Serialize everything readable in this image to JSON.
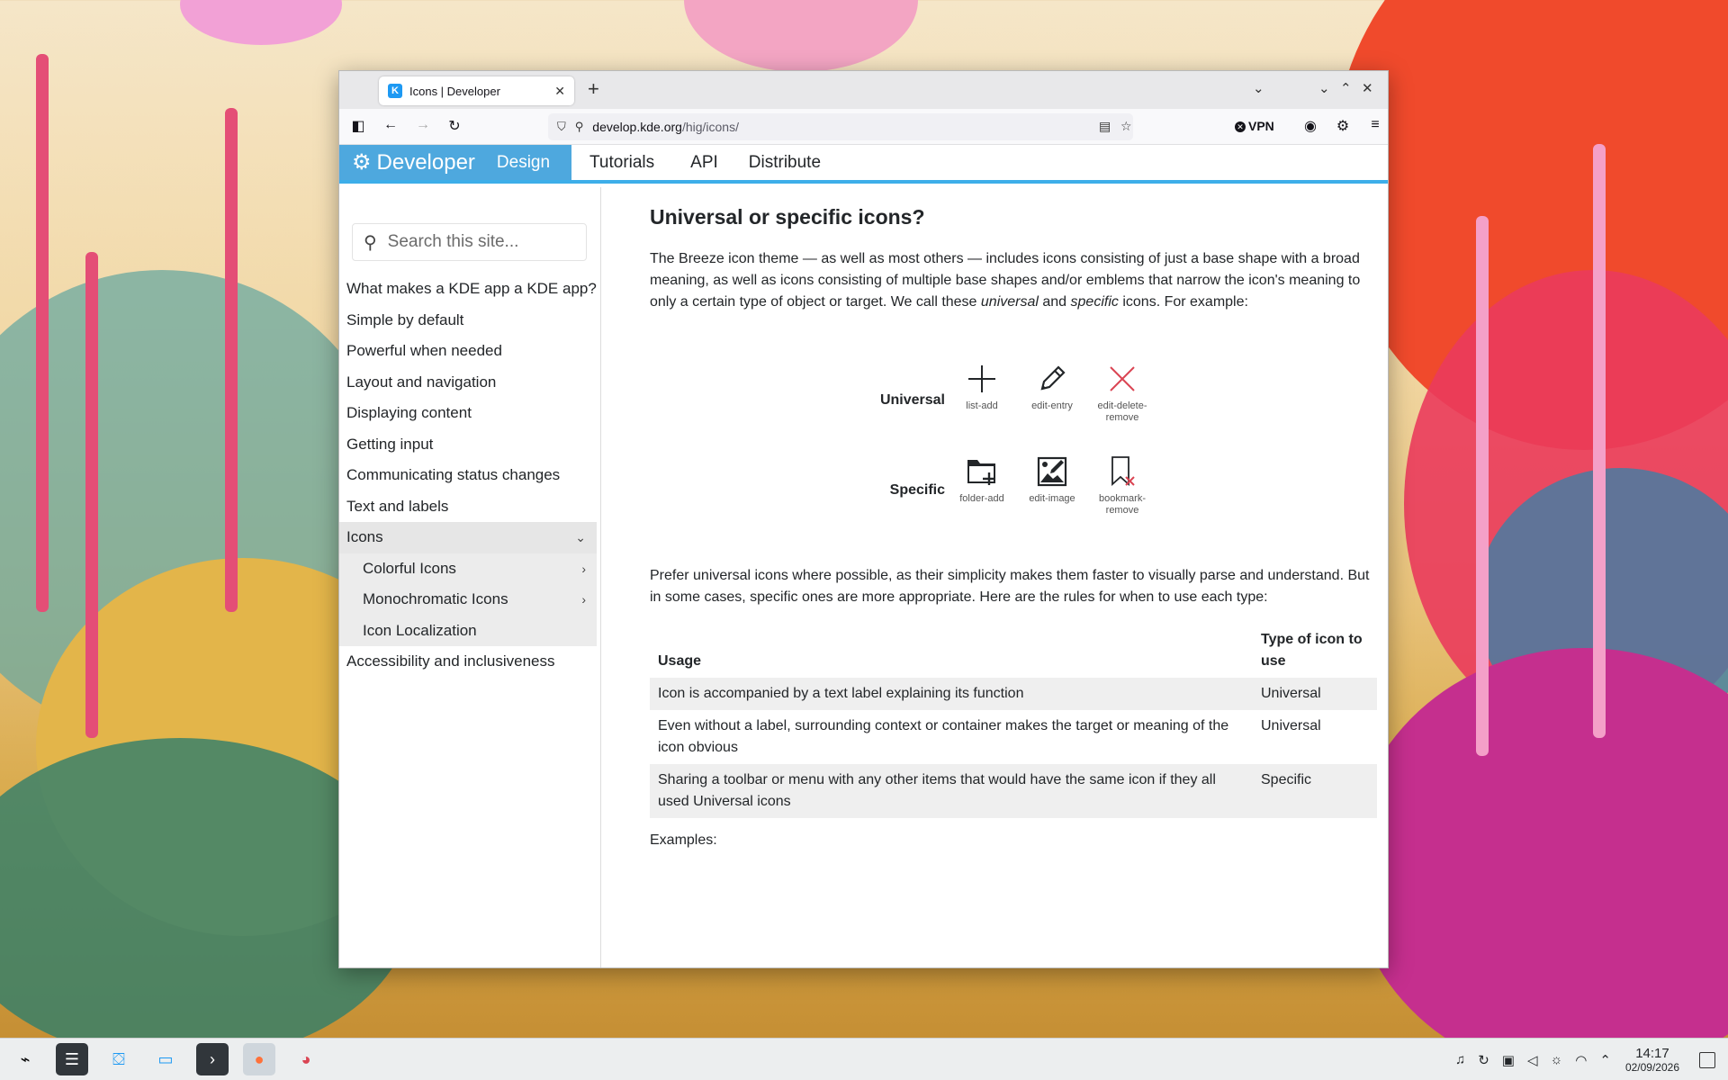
{
  "browser": {
    "tab_title": "Icons | Developer",
    "url_domain": "develop.kde.org",
    "url_path": "/hig/icons/",
    "vpn_label": "VPN"
  },
  "site": {
    "brand": "Developer",
    "nav": [
      "Design",
      "Tutorials",
      "API",
      "Distribute"
    ],
    "search_placeholder": "Search this site..."
  },
  "sidebar": {
    "items": [
      "What makes a KDE app a KDE app?",
      "Simple by default",
      "Powerful when needed",
      "Layout and navigation",
      "Displaying content",
      "Getting input",
      "Communicating status changes",
      "Text and labels"
    ],
    "active": "Icons",
    "sub": [
      "Colorful Icons",
      "Monochromatic Icons",
      "Icon Localization"
    ],
    "after": "Accessibility and inclusiveness"
  },
  "content": {
    "heading": "Universal or specific icons?",
    "p1_a": "The Breeze icon theme — as well as most others — includes icons consisting of just a base shape with a broad meaning, as well as icons consisting of multiple base shapes and/or emblems that narrow the icon's meaning to only a certain type of object or target. We call these ",
    "p1_universal": "universal",
    "p1_and": " and ",
    "p1_specific": "specific",
    "p1_b": " icons. For example:",
    "row_universal": "Universal",
    "row_specific": "Specific",
    "icons_universal": [
      "list-add",
      "edit-entry",
      "edit-delete-remove"
    ],
    "icons_specific": [
      "folder-add",
      "edit-image",
      "bookmark-remove"
    ],
    "p2": "Prefer universal icons where possible, as their simplicity makes them faster to visually parse and understand. But in some cases, specific ones are more appropriate. Here are the rules for when to use each type:",
    "table": {
      "headers": [
        "Usage",
        "Type of icon to use"
      ],
      "rows": [
        [
          "Icon is accompanied by a text label explaining its function",
          "Universal"
        ],
        [
          "Even without a label, surrounding context or container makes the target or meaning of the icon obvious",
          "Universal"
        ],
        [
          "Sharing a toolbar or menu with any other items that would have the same icon if they all used Universal icons",
          "Specific"
        ]
      ]
    },
    "examples": "Examples:"
  },
  "taskbar": {
    "time": "14:17",
    "date": "02/09/2026"
  }
}
